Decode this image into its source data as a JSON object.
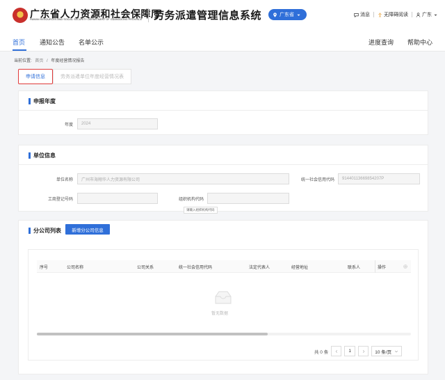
{
  "header": {
    "logo_cn": "广东省人力资源和社会保障厅",
    "logo_en": "HUMAN RESOURCES AND SOCIAL SECURITY DEPARTMENT OF GUANGDONG PROVINCE",
    "system_title": "劳务派遣管理信息系统",
    "region": "广东省",
    "links": {
      "messages": "消息",
      "accessibility": "无障碍阅读",
      "user": "广东"
    }
  },
  "nav": {
    "items": [
      {
        "label": "首页"
      },
      {
        "label": "通知公告"
      },
      {
        "label": "名单公示"
      }
    ],
    "right": [
      {
        "label": "进度查询"
      },
      {
        "label": "帮助中心"
      }
    ]
  },
  "breadcrumb": {
    "prefix": "当前位置:",
    "home": "首页",
    "sep": "/",
    "current": "年度经营情况报告"
  },
  "tabs": [
    {
      "label": "申请信息"
    },
    {
      "label": "劳务派遣单位年度经营情况表"
    }
  ],
  "report_year": {
    "title": "申报年度",
    "year_label": "年度",
    "year_value": "2024"
  },
  "unit_info": {
    "title": "单位信息",
    "name_label": "单位名称",
    "name_value": "广州市海翔华人力资源有限公司",
    "credit_label": "统一社会信用代码",
    "credit_value": "91440113669854207P",
    "biz_reg_label": "工商登记号码",
    "biz_reg_value": "",
    "org_code_label": "组织机构代码",
    "org_code_value": "",
    "tooltip": "请输入组织机构代码"
  },
  "branch_list": {
    "title": "分公司列表",
    "add_button": "新增分公司信息",
    "columns": [
      "序号",
      "公司名称",
      "公司关系",
      "统一社会信用代码",
      "法定代表人",
      "经营地址",
      "联系人",
      "操作"
    ],
    "empty_text": "暂无数据"
  },
  "pager": {
    "total": "共 0 条",
    "page": "1",
    "page_size": "10 条/页"
  },
  "colors": {
    "primary": "#2f6fd9",
    "highlight": "#e03a3a"
  }
}
